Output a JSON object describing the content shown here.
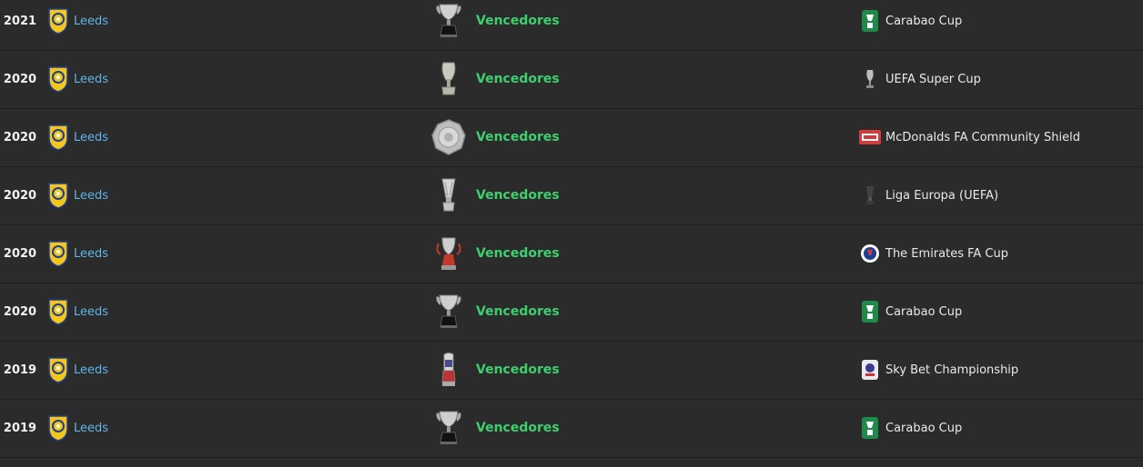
{
  "colors": {
    "background": "#2b2b2b",
    "divider": "#1f1f1f",
    "club_link": "#5fb4e8",
    "result_win": "#3ecf6e",
    "year_text": "#f2f2f2"
  },
  "honours": [
    {
      "year": "2021",
      "club": "Leeds",
      "result": "Vencedores",
      "trophy_icon": "carabao-cup-trophy-icon",
      "competition": "Carabao Cup",
      "comp_icon": "carabao-cup-logo-icon"
    },
    {
      "year": "2020",
      "club": "Leeds",
      "result": "Vencedores",
      "trophy_icon": "uefa-super-cup-trophy-icon",
      "competition": "UEFA Super Cup",
      "comp_icon": "uefa-super-cup-logo-icon"
    },
    {
      "year": "2020",
      "club": "Leeds",
      "result": "Vencedores",
      "trophy_icon": "community-shield-trophy-icon",
      "competition": "McDonalds FA Community Shield",
      "comp_icon": "community-shield-logo-icon"
    },
    {
      "year": "2020",
      "club": "Leeds",
      "result": "Vencedores",
      "trophy_icon": "europa-league-trophy-icon",
      "competition": "Liga Europa (UEFA)",
      "comp_icon": "europa-league-logo-icon"
    },
    {
      "year": "2020",
      "club": "Leeds",
      "result": "Vencedores",
      "trophy_icon": "fa-cup-trophy-icon",
      "competition": "The Emirates FA Cup",
      "comp_icon": "fa-cup-logo-icon"
    },
    {
      "year": "2020",
      "club": "Leeds",
      "result": "Vencedores",
      "trophy_icon": "carabao-cup-trophy-icon",
      "competition": "Carabao Cup",
      "comp_icon": "carabao-cup-logo-icon"
    },
    {
      "year": "2019",
      "club": "Leeds",
      "result": "Vencedores",
      "trophy_icon": "championship-trophy-icon",
      "competition": "Sky Bet Championship",
      "comp_icon": "sky-bet-championship-logo-icon"
    },
    {
      "year": "2019",
      "club": "Leeds",
      "result": "Vencedores",
      "trophy_icon": "carabao-cup-trophy-icon",
      "competition": "Carabao Cup",
      "comp_icon": "carabao-cup-logo-icon"
    }
  ]
}
